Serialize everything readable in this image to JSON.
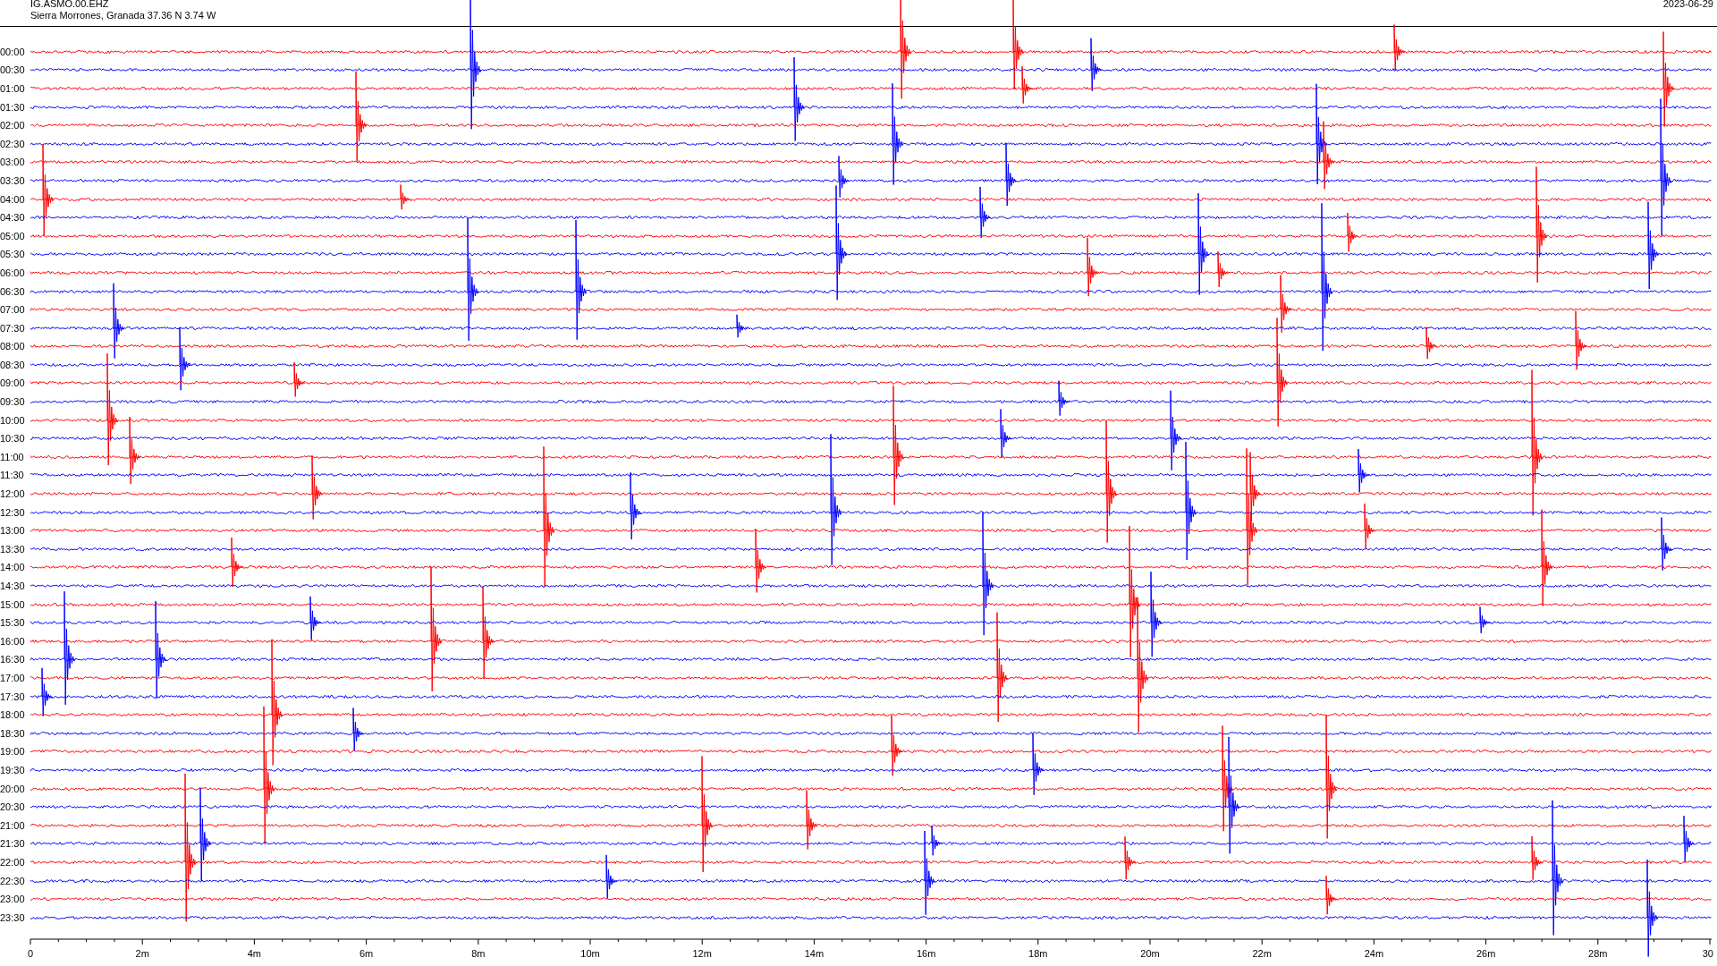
{
  "header": {
    "station": "IG.ASMO.00.EHZ",
    "location": "Sierra Morrones, Granada  37.36 N 3.74 W",
    "date": "2023-06-29"
  },
  "rows": [
    {
      "time": "00:00",
      "color": "#ff0000"
    },
    {
      "time": "00:30",
      "color": "#0000ff"
    },
    {
      "time": "01:00",
      "color": "#ff0000"
    },
    {
      "time": "01:30",
      "color": "#0000ff"
    },
    {
      "time": "02:00",
      "color": "#ff0000"
    },
    {
      "time": "02:30",
      "color": "#0000ff"
    },
    {
      "time": "03:00",
      "color": "#ff0000"
    },
    {
      "time": "03:30",
      "color": "#0000ff"
    },
    {
      "time": "04:00",
      "color": "#ff0000"
    },
    {
      "time": "04:30",
      "color": "#0000ff"
    },
    {
      "time": "05:00",
      "color": "#ff0000"
    },
    {
      "time": "05:30",
      "color": "#0000ff"
    },
    {
      "time": "06:00",
      "color": "#ff0000"
    },
    {
      "time": "06:30",
      "color": "#0000ff"
    },
    {
      "time": "07:00",
      "color": "#ff0000"
    },
    {
      "time": "07:30",
      "color": "#0000ff"
    },
    {
      "time": "08:00",
      "color": "#ff0000"
    },
    {
      "time": "08:30",
      "color": "#0000ff"
    },
    {
      "time": "09:00",
      "color": "#ff0000"
    },
    {
      "time": "09:30",
      "color": "#0000ff"
    },
    {
      "time": "10:00",
      "color": "#ff0000"
    },
    {
      "time": "10:30",
      "color": "#0000ff"
    },
    {
      "time": "11:00",
      "color": "#ff0000"
    },
    {
      "time": "11:30",
      "color": "#0000ff"
    },
    {
      "time": "12:00",
      "color": "#ff0000"
    },
    {
      "time": "12:30",
      "color": "#0000ff"
    },
    {
      "time": "13:00",
      "color": "#ff0000"
    },
    {
      "time": "13:30",
      "color": "#0000ff"
    },
    {
      "time": "14:00",
      "color": "#ff0000"
    },
    {
      "time": "14:30",
      "color": "#0000ff"
    },
    {
      "time": "15:00",
      "color": "#ff0000"
    },
    {
      "time": "15:30",
      "color": "#0000ff"
    },
    {
      "time": "16:00",
      "color": "#ff0000"
    },
    {
      "time": "16:30",
      "color": "#0000ff"
    },
    {
      "time": "17:00",
      "color": "#ff0000"
    },
    {
      "time": "17:30",
      "color": "#0000ff"
    },
    {
      "time": "18:00",
      "color": "#ff0000"
    },
    {
      "time": "18:30",
      "color": "#0000ff"
    },
    {
      "time": "19:00",
      "color": "#ff0000"
    },
    {
      "time": "19:30",
      "color": "#0000ff"
    },
    {
      "time": "20:00",
      "color": "#ff0000"
    },
    {
      "time": "20:30",
      "color": "#0000ff"
    },
    {
      "time": "21:00",
      "color": "#ff0000"
    },
    {
      "time": "21:30",
      "color": "#0000ff"
    },
    {
      "time": "22:00",
      "color": "#ff0000"
    },
    {
      "time": "22:30",
      "color": "#0000ff"
    },
    {
      "time": "23:00",
      "color": "#ff0000"
    },
    {
      "time": "23:30",
      "color": "#0000ff"
    }
  ],
  "x_axis": {
    "labels": [
      "0",
      "2m",
      "4m",
      "6m",
      "8m",
      "10m",
      "12m",
      "14m",
      "16m",
      "18m",
      "20m",
      "22m",
      "24m",
      "26m",
      "28m",
      "30"
    ]
  }
}
